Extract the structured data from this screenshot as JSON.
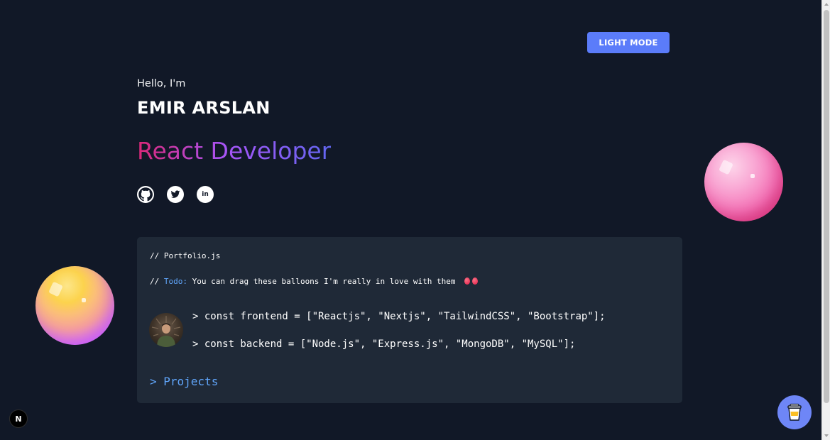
{
  "header": {
    "mode_button_label": "LIGHT MODE"
  },
  "hero": {
    "greeting": "Hello, I'm",
    "name": "EMIR ARSLAN",
    "role": "React Developer",
    "socials": [
      {
        "icon": "github-icon"
      },
      {
        "icon": "twitter-icon"
      },
      {
        "icon": "linkedin-icon",
        "text": "in"
      }
    ]
  },
  "code_card": {
    "file_comment": "// Portfolio.js",
    "todo_prefix": "// ",
    "todo_keyword": "Todo:",
    "todo_text": " You can drag these balloons I'm really in love with them",
    "frontend_line": "> const frontend = [\"Reactjs\", \"Nextjs\", \"TailwindCSS\", \"Bootstrap\"];",
    "backend_line": "> const backend = [\"Node.js\", \"Express.js\", \"MongoDB\", \"MySQL\"];",
    "projects_link": "> Projects"
  },
  "next_badge": {
    "label": "N"
  },
  "colors": {
    "background": "#111827",
    "card": "#1f2937",
    "accent_blue": "#60a5fa",
    "button": "#5b7cfa",
    "gradient_start": "#db2777",
    "gradient_end": "#6366f1"
  }
}
